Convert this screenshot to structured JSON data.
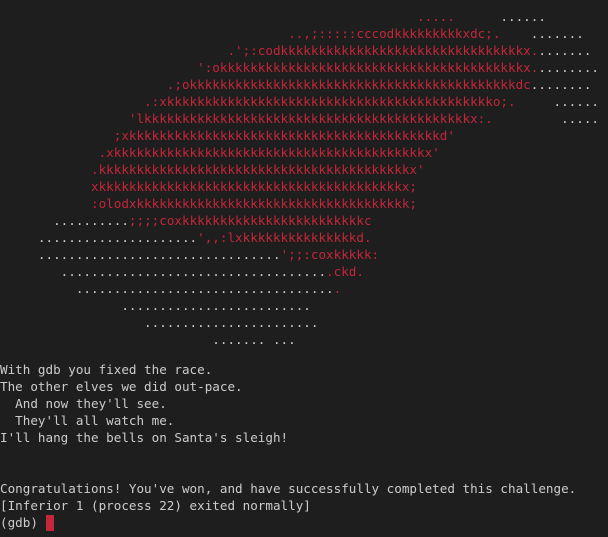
{
  "terminal": {
    "colors": {
      "background": "#1e1e1e",
      "text": "#cccccc",
      "red": "#c2273a"
    },
    "art_lines": [
      [
        {
          "t": "                                                       .....      ",
          "c": "red"
        },
        {
          "t": "......",
          "c": "white"
        }
      ],
      [
        {
          "t": "                                      ..,;:::::cccodkkkkkkkkkxdc;.    ",
          "c": "red"
        },
        {
          "t": ".......",
          "c": "white"
        }
      ],
      [
        {
          "t": "                              .';:codkkkkkkkkkkkkkkkkkkkkkkkkkkkkkkkkx.",
          "c": "red"
        },
        {
          "t": ".......",
          "c": "white"
        }
      ],
      [
        {
          "t": "                          ':okkkkkkkkkkkkkkkkkkkkkkkkkkkkkkkkkkkkkkkkx.",
          "c": "red"
        },
        {
          "t": "........",
          "c": "white"
        }
      ],
      [
        {
          "t": "                      .;okkkkkkkkkkkkkkkkkkkkkkkkkkkkkkkkkkkkkkkkkkkdc",
          "c": "red"
        },
        {
          "t": "........",
          "c": "white"
        }
      ],
      [
        {
          "t": "                   .:xkkkkkkkkkkkkkkkkkkkkkkkkkkkkkkkkkkkkkkkkkkko;.     ",
          "c": "red"
        },
        {
          "t": "......",
          "c": "white"
        }
      ],
      [
        {
          "t": "                 'lkkkkkkkkkkkkkkkkkkkkkkkkkkkkkkkkkkkkkkkkkkkx:.         ",
          "c": "red"
        },
        {
          "t": ".....",
          "c": "white"
        }
      ],
      [
        {
          "t": "               ;xkkkkkkkkkkkkkkkkkkkkkkkkkkkkkkkkkkkkkkkkkd'",
          "c": "red"
        }
      ],
      [
        {
          "t": "             .xkkkkkkkkkkkkkkkkkkkkkkkkkkkkkkkkkkkkkkkkkx'",
          "c": "red"
        }
      ],
      [
        {
          "t": "            .kkkkkkkkkkkkkkkkkkkkkkkkkkkkkkkkkkkkkkkkkx'",
          "c": "red"
        }
      ],
      [
        {
          "t": "            xkkkkkkkkkkkkkkkkkkkkkkkkkkkkkkkkkkkkkkkkx;",
          "c": "red"
        }
      ],
      [
        {
          "t": "            :olodxkkkkkkkkkkkkkkkkkkkkkkkkkkkkkkkkkkkk;",
          "c": "red"
        }
      ],
      [
        {
          "t": "       ..........",
          "c": "white"
        },
        {
          "t": ";;;;coxkkkkkkkkkkkkkkkkkkkkkkkkc",
          "c": "red"
        }
      ],
      [
        {
          "t": "     .....................",
          "c": "white"
        },
        {
          "t": "',,:lxkkkkkkkkkkkkkkkd.",
          "c": "red"
        }
      ],
      [
        {
          "t": "     ................................",
          "c": "white"
        },
        {
          "t": "';;:coxkkkkk:",
          "c": "red"
        }
      ],
      [
        {
          "t": "        ...................................",
          "c": "white"
        },
        {
          "t": ".ckd.",
          "c": "red"
        }
      ],
      [
        {
          "t": "          ..................................",
          "c": "white"
        },
        {
          "t": ".",
          "c": "red"
        }
      ],
      [
        {
          "t": "                .........................",
          "c": "white"
        }
      ],
      [
        {
          "t": "                   .......................",
          "c": "white"
        }
      ],
      [
        {
          "t": "                            ....... ...",
          "c": "white"
        }
      ]
    ],
    "output_lines": [
      "With gdb you fixed the race.",
      "The other elves we did out-pace.",
      "  And now they'll see.",
      "  They'll all watch me.",
      "I'll hang the bells on Santa's sleigh!",
      "",
      "",
      "Congratulations! You've won, and have successfully completed this challenge.",
      "[Inferior 1 (process 22) exited normally]"
    ],
    "prompt": "(gdb)"
  }
}
